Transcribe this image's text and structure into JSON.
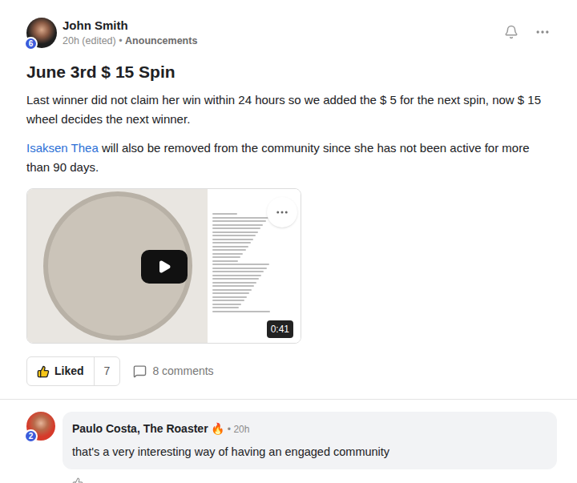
{
  "post": {
    "author": "John Smith",
    "author_badge": "6",
    "time": "20h (edited)",
    "separator": "•",
    "category": "Anouncements",
    "title": "June 3rd $ 15 Spin",
    "paragraph": "Last winner did not claim her win within 24 hours so we added the $ 5 for the next spin, now $ 15 wheel decides the next winner.",
    "mention": "Isaksen Thea",
    "mention_rest": " will also be removed from the community since she has not been active for more than 90 days.",
    "video": {
      "duration": "0:41"
    },
    "actions": {
      "like_label": "Liked",
      "liked": true,
      "like_count": "7",
      "comments": "8 comments"
    }
  },
  "comment": {
    "author": "Paulo Costa, The Roaster",
    "emoji": "🔥",
    "separator": "•",
    "time": "20h",
    "author_badge": "2",
    "text": "that's a very interesting way of having an engaged community"
  }
}
